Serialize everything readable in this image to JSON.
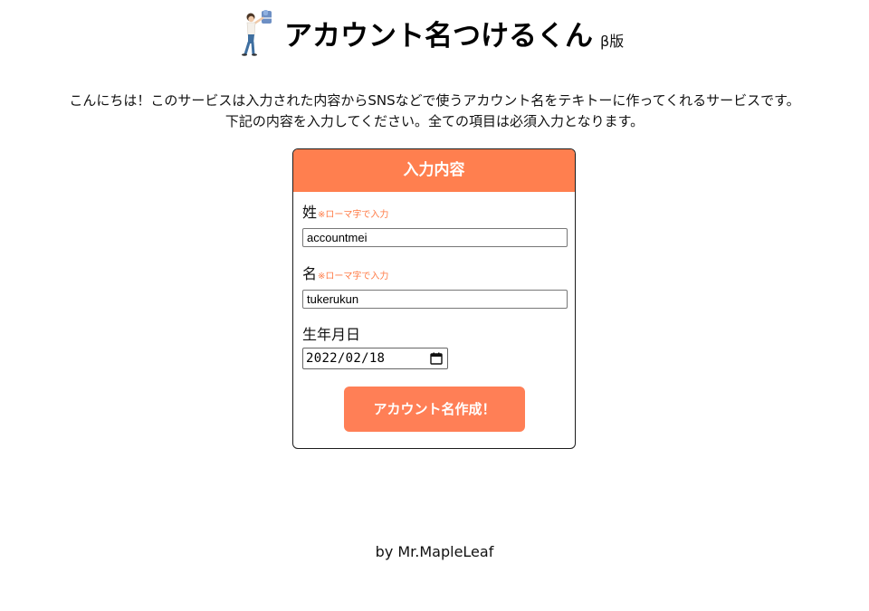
{
  "header": {
    "mascot_icon": "person-thumbs-up-icon",
    "title": "アカウント名つけるくん",
    "beta_label": "β版"
  },
  "intro": {
    "line1": "こんにちは！このサービスは入力された内容からSNSなどで使うアカウント名をテキトーに作ってくれるサービスです。",
    "line2": "下記の内容を入力してください。全ての項目は必須入力となります。"
  },
  "form": {
    "heading": "入力内容",
    "accent_color": "#ff7f4f",
    "note_color": "#ff7a45",
    "last_name": {
      "label": "姓",
      "note": "※ローマ字で入力",
      "value": "accountmei"
    },
    "first_name": {
      "label": "名",
      "note": "※ローマ字で入力",
      "value": "tukerukun"
    },
    "birthday": {
      "label": "生年月日",
      "value": "2022/02/18",
      "icon": "calendar-icon"
    },
    "submit_label": "アカウント名作成！"
  },
  "footer": {
    "credit": "by Mr.MapleLeaf"
  }
}
